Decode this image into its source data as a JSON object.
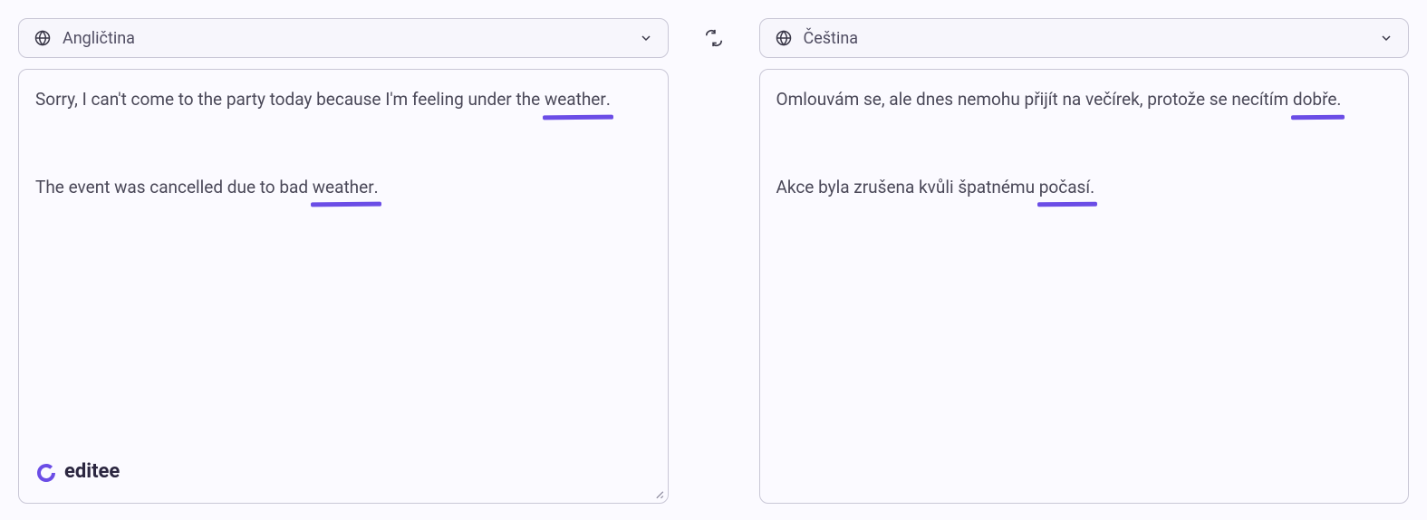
{
  "source": {
    "language": "Angličtina",
    "line1_pre": "Sorry, I can't come to the party today because I'm feeling under the ",
    "line1_word": "weather",
    "line1_post": ".",
    "line2_pre": "The event was cancelled due to bad ",
    "line2_word": "weather",
    "line2_post": "."
  },
  "target": {
    "language": "Čeština",
    "line1_pre": "Omlouvám se, ale dnes nemohu přijít na večírek, protože se necítím ",
    "line1_word": "dobře",
    "line1_post": ".",
    "line2_pre": "Akce byla zrušena kvůli špatnému ",
    "line2_word": "počasí",
    "line2_post": "."
  },
  "brand": "editee"
}
